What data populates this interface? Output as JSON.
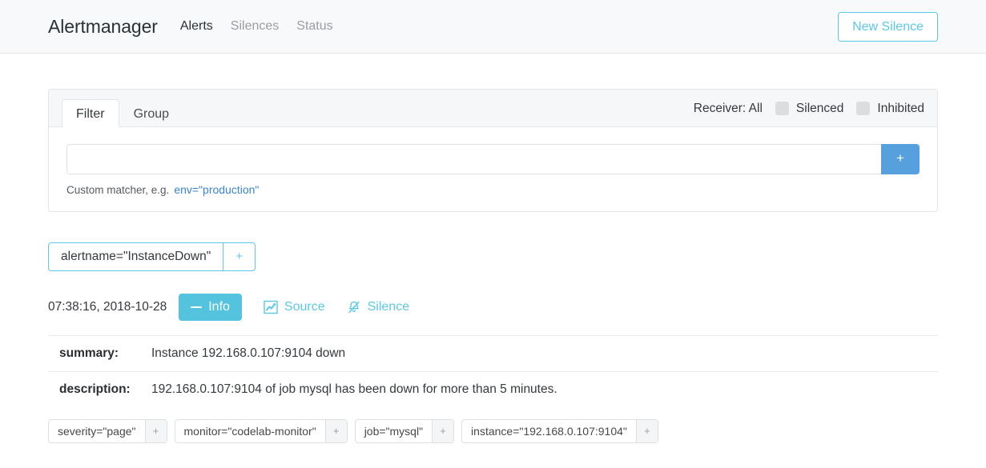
{
  "navbar": {
    "brand": "Alertmanager",
    "links": [
      {
        "label": "Alerts",
        "active": true
      },
      {
        "label": "Silences",
        "active": false
      },
      {
        "label": "Status",
        "active": false
      }
    ],
    "new_silence_label": "New Silence"
  },
  "filter_card": {
    "tabs": [
      {
        "label": "Filter",
        "active": true
      },
      {
        "label": "Group",
        "active": false
      }
    ],
    "receiver_label": "Receiver: All",
    "checkboxes": [
      {
        "label": "Silenced",
        "checked": false
      },
      {
        "label": "Inhibited",
        "checked": false
      }
    ],
    "matcher_input_value": "",
    "matcher_input_placeholder": "",
    "add_button_label": "+",
    "helper_text": "Custom matcher, e.g.",
    "helper_code": "env=\"production\""
  },
  "group": {
    "matcher_label": "alertname=\"InstanceDown\"",
    "matcher_plus_label": "+"
  },
  "alert": {
    "timestamp": "07:38:16, 2018-10-28",
    "info_button_label": "Info",
    "source_link_label": "Source",
    "silence_link_label": "Silence",
    "annotations": [
      {
        "key": "summary:",
        "value": "Instance 192.168.0.107:9104 down"
      },
      {
        "key": "description:",
        "value": "192.168.0.107:9104 of job mysql has been down for more than 5 minutes."
      }
    ],
    "labels": [
      {
        "text": "severity=\"page\"",
        "plus": "+"
      },
      {
        "text": "monitor=\"codelab-monitor\"",
        "plus": "+"
      },
      {
        "text": "job=\"mysql\"",
        "plus": "+"
      },
      {
        "text": "instance=\"192.168.0.107:9104\"",
        "plus": "+"
      }
    ]
  },
  "colors": {
    "accent_cyan": "#5bc8e8",
    "info_cyan": "#54c4de",
    "add_blue": "#56a0de",
    "link_blue": "#3b84d0",
    "navbar_bg": "#f8f9fa"
  }
}
